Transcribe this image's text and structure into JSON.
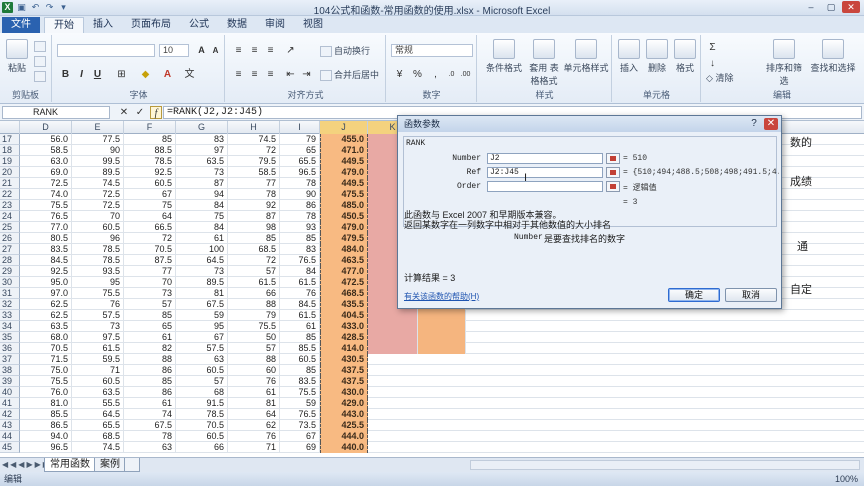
{
  "window": {
    "title": "104公式和函数-常用函数的使用.xlsx - Microsoft Excel"
  },
  "ribbon": {
    "tabs": [
      "文件",
      "开始",
      "插入",
      "页面布局",
      "公式",
      "数据",
      "审阅",
      "视图"
    ],
    "groups": {
      "clipboard": "剪贴板",
      "font": "字体",
      "alignment": "对齐方式",
      "number": "数字",
      "styles": "样式",
      "cells": "单元格",
      "editing": "编辑"
    },
    "paste_label": "粘贴",
    "font_size": "10",
    "wrap_text": "自动换行",
    "merge_center": "合并后居中",
    "number_format": "常规",
    "conditional_format": "条件格式",
    "table_format": "套用\n表格格式",
    "cell_styles": "单元格样式",
    "insert": "插入",
    "delete": "删除",
    "format": "格式",
    "clear": "清除",
    "sort_filter": "排序和筛选",
    "find_select": "查找和选择"
  },
  "formula_bar": {
    "name_box": "RANK",
    "formula": "=RANK(J2,J2:J45)"
  },
  "grid": {
    "columns": [
      "D",
      "E",
      "F",
      "G",
      "H",
      "I",
      "J",
      "K",
      "L"
    ],
    "rows": [
      {
        "n": "17",
        "d": "56.0",
        "e": "77.5",
        "f": "85",
        "g": "83",
        "h": "74.5",
        "i": "79",
        "j": "455.0"
      },
      {
        "n": "18",
        "d": "58.5",
        "e": "90",
        "f": "88.5",
        "g": "97",
        "h": "72",
        "i": "65",
        "j": "471.0"
      },
      {
        "n": "19",
        "d": "63.0",
        "e": "99.5",
        "f": "78.5",
        "g": "63.5",
        "h": "79.5",
        "i": "65.5",
        "j": "449.5"
      },
      {
        "n": "20",
        "d": "69.0",
        "e": "89.5",
        "f": "92.5",
        "g": "73",
        "h": "58.5",
        "i": "96.5",
        "j": "479.0"
      },
      {
        "n": "21",
        "d": "72.5",
        "e": "74.5",
        "f": "60.5",
        "g": "87",
        "h": "77",
        "i": "78",
        "j": "449.5"
      },
      {
        "n": "22",
        "d": "74.0",
        "e": "72.5",
        "f": "67",
        "g": "94",
        "h": "78",
        "i": "90",
        "j": "475.5"
      },
      {
        "n": "23",
        "d": "75.5",
        "e": "72.5",
        "f": "75",
        "g": "84",
        "h": "92",
        "i": "86",
        "j": "485.0"
      },
      {
        "n": "24",
        "d": "76.5",
        "e": "70",
        "f": "64",
        "g": "75",
        "h": "87",
        "i": "78",
        "j": "450.5"
      },
      {
        "n": "25",
        "d": "77.0",
        "e": "60.5",
        "f": "66.5",
        "g": "84",
        "h": "98",
        "i": "93",
        "j": "479.0"
      },
      {
        "n": "26",
        "d": "80.5",
        "e": "96",
        "f": "72",
        "g": "61",
        "h": "85",
        "i": "85",
        "j": "479.5"
      },
      {
        "n": "27",
        "d": "83.5",
        "e": "78.5",
        "f": "70.5",
        "g": "100",
        "h": "68.5",
        "i": "83",
        "j": "484.0"
      },
      {
        "n": "28",
        "d": "84.5",
        "e": "78.5",
        "f": "87.5",
        "g": "64.5",
        "h": "72",
        "i": "76.5",
        "j": "463.5"
      },
      {
        "n": "29",
        "d": "92.5",
        "e": "93.5",
        "f": "77",
        "g": "73",
        "h": "57",
        "i": "84",
        "j": "477.0"
      },
      {
        "n": "30",
        "d": "95.0",
        "e": "95",
        "f": "70",
        "g": "89.5",
        "h": "61.5",
        "i": "61.5",
        "j": "472.5"
      },
      {
        "n": "31",
        "d": "97.0",
        "e": "75.5",
        "f": "73",
        "g": "81",
        "h": "66",
        "i": "76",
        "j": "468.5"
      },
      {
        "n": "32",
        "d": "62.5",
        "e": "76",
        "f": "57",
        "g": "67.5",
        "h": "88",
        "i": "84.5",
        "j": "435.5"
      },
      {
        "n": "33",
        "d": "62.5",
        "e": "57.5",
        "f": "85",
        "g": "59",
        "h": "79",
        "i": "61.5",
        "j": "404.5"
      },
      {
        "n": "34",
        "d": "63.5",
        "e": "73",
        "f": "65",
        "g": "95",
        "h": "75.5",
        "i": "61",
        "j": "433.0"
      },
      {
        "n": "35",
        "d": "68.0",
        "e": "97.5",
        "f": "61",
        "g": "67",
        "h": "50",
        "i": "85",
        "j": "428.5"
      },
      {
        "n": "36",
        "d": "70.5",
        "e": "61.5",
        "f": "82",
        "g": "57.5",
        "h": "57",
        "i": "85.5",
        "j": "414.0"
      },
      {
        "n": "37",
        "d": "71.5",
        "e": "59.5",
        "f": "88",
        "g": "63",
        "h": "88",
        "i": "60.5",
        "j": "430.5"
      },
      {
        "n": "38",
        "d": "75.0",
        "e": "71",
        "f": "86",
        "g": "60.5",
        "h": "60",
        "i": "85",
        "j": "437.5"
      },
      {
        "n": "39",
        "d": "75.5",
        "e": "60.5",
        "f": "85",
        "g": "57",
        "h": "76",
        "i": "83.5",
        "j": "437.5"
      },
      {
        "n": "40",
        "d": "76.0",
        "e": "63.5",
        "f": "86",
        "g": "68",
        "h": "61",
        "i": "75.5",
        "j": "430.0"
      },
      {
        "n": "41",
        "d": "81.0",
        "e": "55.5",
        "f": "61",
        "g": "91.5",
        "h": "81",
        "i": "59",
        "j": "429.0"
      },
      {
        "n": "42",
        "d": "85.5",
        "e": "64.5",
        "f": "74",
        "g": "78.5",
        "h": "64",
        "i": "76.5",
        "j": "443.0"
      },
      {
        "n": "43",
        "d": "86.5",
        "e": "65.5",
        "f": "67.5",
        "g": "70.5",
        "h": "62",
        "i": "73.5",
        "j": "425.5"
      },
      {
        "n": "44",
        "d": "94.0",
        "e": "68.5",
        "f": "78",
        "g": "60.5",
        "h": "76",
        "i": "67",
        "j": "444.0"
      },
      {
        "n": "45",
        "d": "96.5",
        "e": "74.5",
        "f": "63",
        "g": "66",
        "h": "71",
        "i": "69",
        "j": "440.0"
      }
    ],
    "side_texts": [
      "数的",
      "成绩",
      "通",
      "自定"
    ]
  },
  "sheet_tabs": [
    "常用函数",
    "案例"
  ],
  "status": {
    "mode": "编辑",
    "zoom": "100%"
  },
  "dialog": {
    "title": "函数参数",
    "function_name": "RANK",
    "args": [
      {
        "label": "Number",
        "value": "J2",
        "result": "= 510"
      },
      {
        "label": "Ref",
        "value": "J2:J45",
        "result": "= {510;494;488.5;508;498;491.5;4..."
      },
      {
        "label": "Order",
        "value": "",
        "result": "= 逻辑值"
      }
    ],
    "function_result_inline": "= 3",
    "description_line1": "此函数与 Excel 2007 和早期版本兼容。",
    "description_line2": "返回某数字在一列数字中相对于其他数值的大小排名",
    "arg_help_name": "Number",
    "arg_help_text": "是要查找排名的数字",
    "calc_result_label": "计算结果 = ",
    "calc_result_value": "3",
    "help_link": "有关该函数的帮助(H)",
    "ok": "确定",
    "cancel": "取消"
  }
}
